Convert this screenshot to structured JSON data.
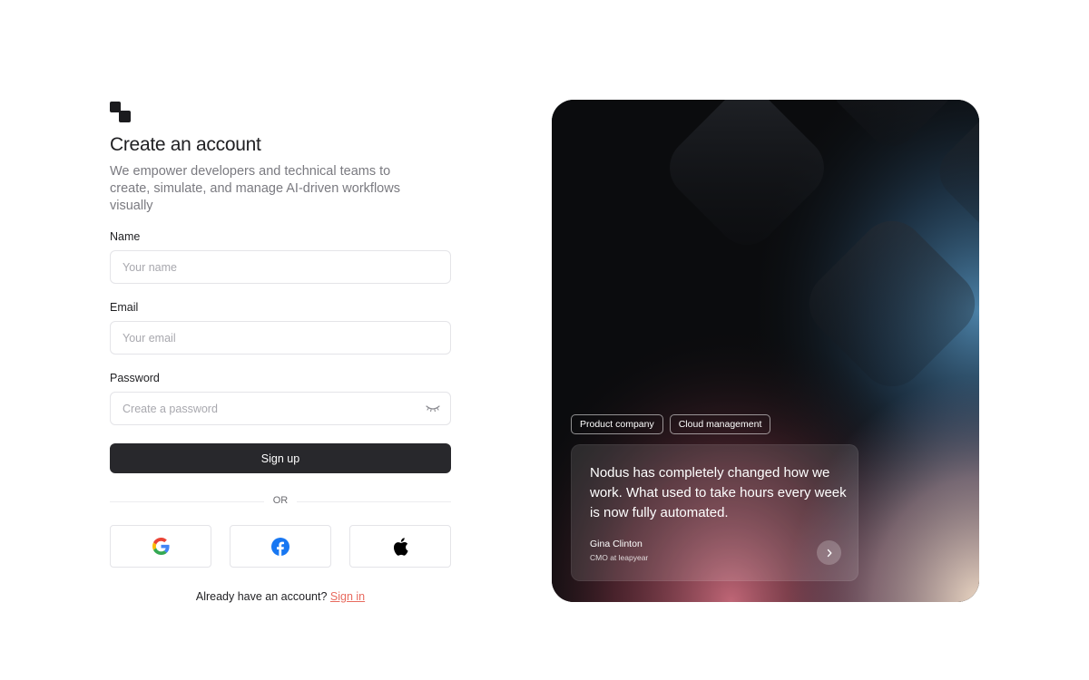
{
  "brand": {
    "logo_icon": "stacked-squares-logo"
  },
  "header": {
    "title": "Create an account",
    "subtitle": "We empower developers and technical teams to create, simulate, and manage AI-driven workflows visually"
  },
  "form": {
    "name": {
      "label": "Name",
      "placeholder": "Your name",
      "value": ""
    },
    "email": {
      "label": "Email",
      "placeholder": "Your email",
      "value": ""
    },
    "password": {
      "label": "Password",
      "placeholder": "Create a password",
      "value": "",
      "toggle_icon": "eye-closed-icon"
    },
    "submit_label": "Sign up"
  },
  "divider": {
    "label": "OR"
  },
  "social": [
    {
      "provider": "Google",
      "icon": "google-icon"
    },
    {
      "provider": "Facebook",
      "icon": "facebook-icon"
    },
    {
      "provider": "Apple",
      "icon": "apple-icon"
    }
  ],
  "signin": {
    "prompt": "Already have an account?",
    "link_label": "Sign in"
  },
  "colors": {
    "primary_button": "#28282c",
    "link": "#e86a5e",
    "facebook_blue": "#1877f2"
  },
  "testimonial": {
    "tags": [
      "Product company",
      "Cloud management"
    ],
    "quote": "Nodus has completely changed how we work. What used to take hours every week is now fully automated.",
    "author": "Gina Clinton",
    "role": "CMO at leapyear",
    "next_icon": "chevron-right-icon"
  }
}
